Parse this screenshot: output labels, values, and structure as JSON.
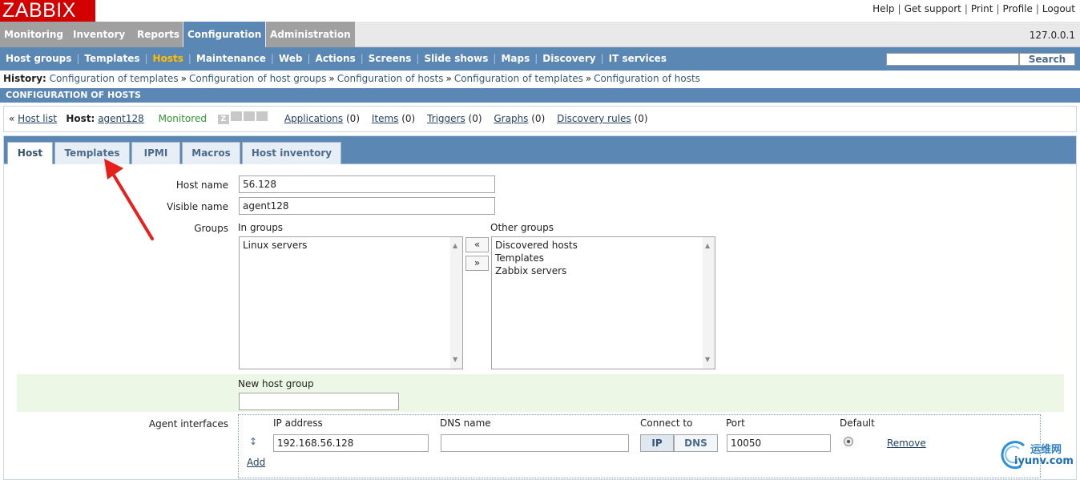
{
  "logo": "ZABBIX",
  "top_links": [
    "Help",
    "Get support",
    "Print",
    "Profile",
    "Logout"
  ],
  "main_menu": [
    "Monitoring",
    "Inventory",
    "Reports",
    "Configuration",
    "Administration"
  ],
  "server_ip": "127.0.0.1",
  "sub_menu": [
    "Host groups",
    "Templates",
    "Hosts",
    "Maintenance",
    "Web",
    "Actions",
    "Screens",
    "Slide shows",
    "Maps",
    "Discovery",
    "IT services"
  ],
  "search": {
    "value": "",
    "button": "Search"
  },
  "history": {
    "label": "History:",
    "items": [
      "Configuration of templates",
      "Configuration of host groups",
      "Configuration of hosts",
      "Configuration of templates",
      "Configuration of hosts"
    ],
    "sep": "»"
  },
  "page_title": "CONFIGURATION OF HOSTS",
  "host_bar": {
    "back": "«",
    "host_list": "Host list",
    "host_label": "Host:",
    "host_name": "agent128",
    "status": "Monitored",
    "availability": [
      "Z",
      "SNMP",
      "JMX",
      "IPMI"
    ],
    "links": [
      {
        "label": "Applications",
        "count": "(0)"
      },
      {
        "label": "Items",
        "count": "(0)"
      },
      {
        "label": "Triggers",
        "count": "(0)"
      },
      {
        "label": "Graphs",
        "count": "(0)"
      },
      {
        "label": "Discovery rules",
        "count": "(0)"
      }
    ]
  },
  "tabs": [
    "Host",
    "Templates",
    "IPMI",
    "Macros",
    "Host inventory"
  ],
  "form": {
    "host_name_label": "Host name",
    "host_name_value": "56.128",
    "visible_name_label": "Visible name",
    "visible_name_value": "agent128",
    "groups_label": "Groups",
    "in_groups_label": "In groups",
    "in_groups": [
      "Linux servers"
    ],
    "other_groups_label": "Other groups",
    "other_groups": [
      "Discovered hosts",
      "Templates",
      "Zabbix servers"
    ],
    "move_left": "«",
    "move_right": "»",
    "new_host_group_label": "New host group",
    "new_host_group_value": "",
    "agent_interfaces_label": "Agent interfaces",
    "iface_headers": {
      "ip": "IP address",
      "dns": "DNS name",
      "connect": "Connect to",
      "port": "Port",
      "default": "Default"
    },
    "iface": {
      "ip": "192.168.56.128",
      "dns": "",
      "connect_ip": "IP",
      "connect_dns": "DNS",
      "port": "10050",
      "remove": "Remove"
    },
    "add": "Add"
  },
  "watermark": {
    "top": "运维网",
    "bottom": "iyunv.com"
  },
  "colors": {
    "brand_red": "#d40000",
    "nav_blue": "#5b87b4",
    "active_sub": "#ffbf00",
    "monitored_green": "#2e9a2e"
  }
}
